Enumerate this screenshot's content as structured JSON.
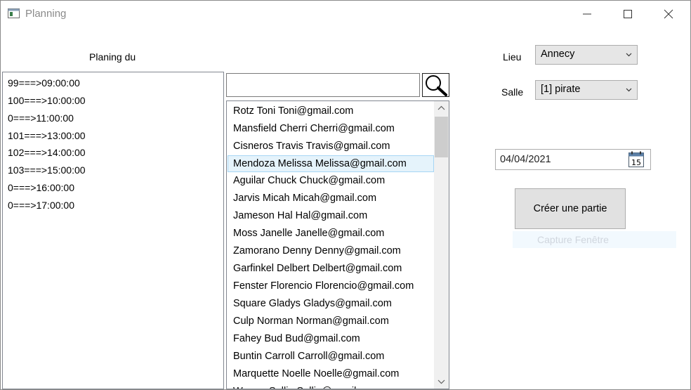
{
  "window": {
    "title": "Planning"
  },
  "planning": {
    "label": "Planing du",
    "items": [
      "99===>09:00:00",
      "100===>10:00:00",
      "0===>11:00:00",
      "101===>13:00:00",
      "102===>14:00:00",
      "103===>15:00:00",
      "0===>16:00:00",
      "0===>17:00:00"
    ]
  },
  "search": {
    "value": ""
  },
  "players": {
    "selected_index": 3,
    "items": [
      "Rotz Toni Toni@gmail.com",
      "Mansfield Cherri Cherri@gmail.com",
      "Cisneros Travis Travis@gmail.com",
      "Mendoza Melissa Melissa@gmail.com",
      "Aguilar Chuck Chuck@gmail.com",
      "Jarvis Micah Micah@gmail.com",
      "Jameson Hal Hal@gmail.com",
      "Moss Janelle Janelle@gmail.com",
      "Zamorano Denny Denny@gmail.com",
      "Garfinkel Delbert Delbert@gmail.com",
      "Fenster Florencio Florencio@gmail.com",
      "Square Gladys Gladys@gmail.com",
      "Culp Norman Norman@gmail.com",
      "Fahey Bud Bud@gmail.com",
      "Buntin Carroll Carroll@gmail.com",
      "Marquette Noelle Noelle@gmail.com",
      "Warren Sallie Sallie@gmail.com"
    ]
  },
  "lieu": {
    "label": "Lieu",
    "value": "Annecy"
  },
  "salle": {
    "label": "Salle",
    "value": "[1] pirate"
  },
  "date": {
    "value": "04/04/2021",
    "calendar_day": "15"
  },
  "create_button": {
    "label": "Créer une partie"
  },
  "capture": {
    "label": "Capture Fenêtre"
  },
  "colors": {
    "selection_bg": "#e5f3fb",
    "selection_border": "#a6d6f4",
    "button_bg": "#e1e1e1"
  }
}
